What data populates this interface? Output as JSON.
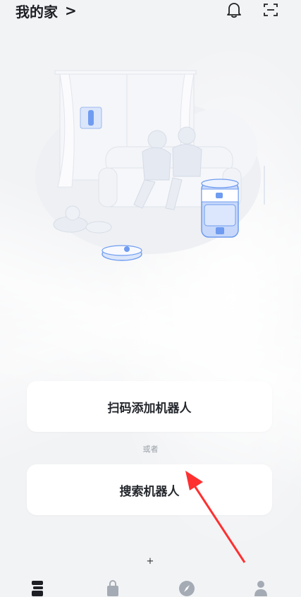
{
  "header": {
    "title": "我的家",
    "title_chevron": ">",
    "icons": {
      "notification": "bell-icon",
      "scan": "scan-icon"
    }
  },
  "actions": {
    "scan_add": "扫码添加机器人",
    "or": "或者",
    "search": "搜索机器人"
  },
  "misc": {
    "plus": "+"
  },
  "tabbar": {
    "items": [
      {
        "icon": "robot-home-icon"
      },
      {
        "icon": "shopping-bag-icon"
      },
      {
        "icon": "compass-icon"
      },
      {
        "icon": "person-icon"
      }
    ]
  },
  "colors": {
    "accent": "#6f9cf0",
    "arrow": "#ff3030",
    "text": "#24272c"
  }
}
